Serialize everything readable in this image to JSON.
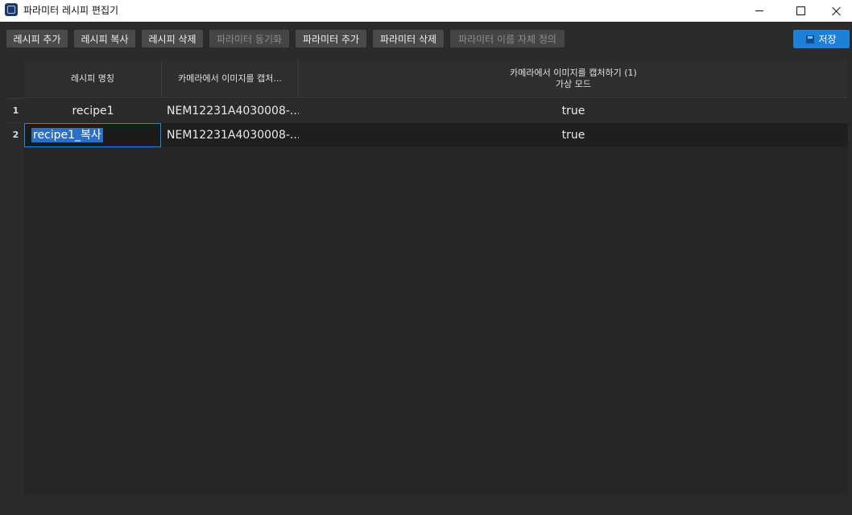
{
  "window": {
    "title": "파라미터 레시피 편집기"
  },
  "toolbar": {
    "buttons": [
      {
        "label": "레시피 추가",
        "enabled": true
      },
      {
        "label": "레시피 복사",
        "enabled": true
      },
      {
        "label": "레시피 삭제",
        "enabled": true
      },
      {
        "label": "파라미터 동기화",
        "enabled": false
      },
      {
        "label": "파라미터 추가",
        "enabled": true
      },
      {
        "label": "파라미터 삭제",
        "enabled": true
      },
      {
        "label": "파라미터 이름 자체 정의",
        "enabled": false
      }
    ],
    "save": {
      "label": "저장",
      "icon": "save-icon",
      "color": "#1e7fd6"
    }
  },
  "grid": {
    "columns": [
      {
        "line1": "레시피 명칭",
        "line2": ""
      },
      {
        "line1": "카메라에서 이미지를 캡처...",
        "line2": ""
      },
      {
        "line1": "카메라에서 이미지를 캡처하기 (1)",
        "line2": "가상 모드"
      }
    ],
    "rows": [
      {
        "num": "1",
        "name": "recipe1",
        "camera": "NEM12231A4030008-...",
        "virtual": "true"
      },
      {
        "num": "2",
        "name": "recipe1_복사",
        "camera": "NEM12231A4030008-...",
        "virtual": "true",
        "editing": true
      }
    ]
  }
}
